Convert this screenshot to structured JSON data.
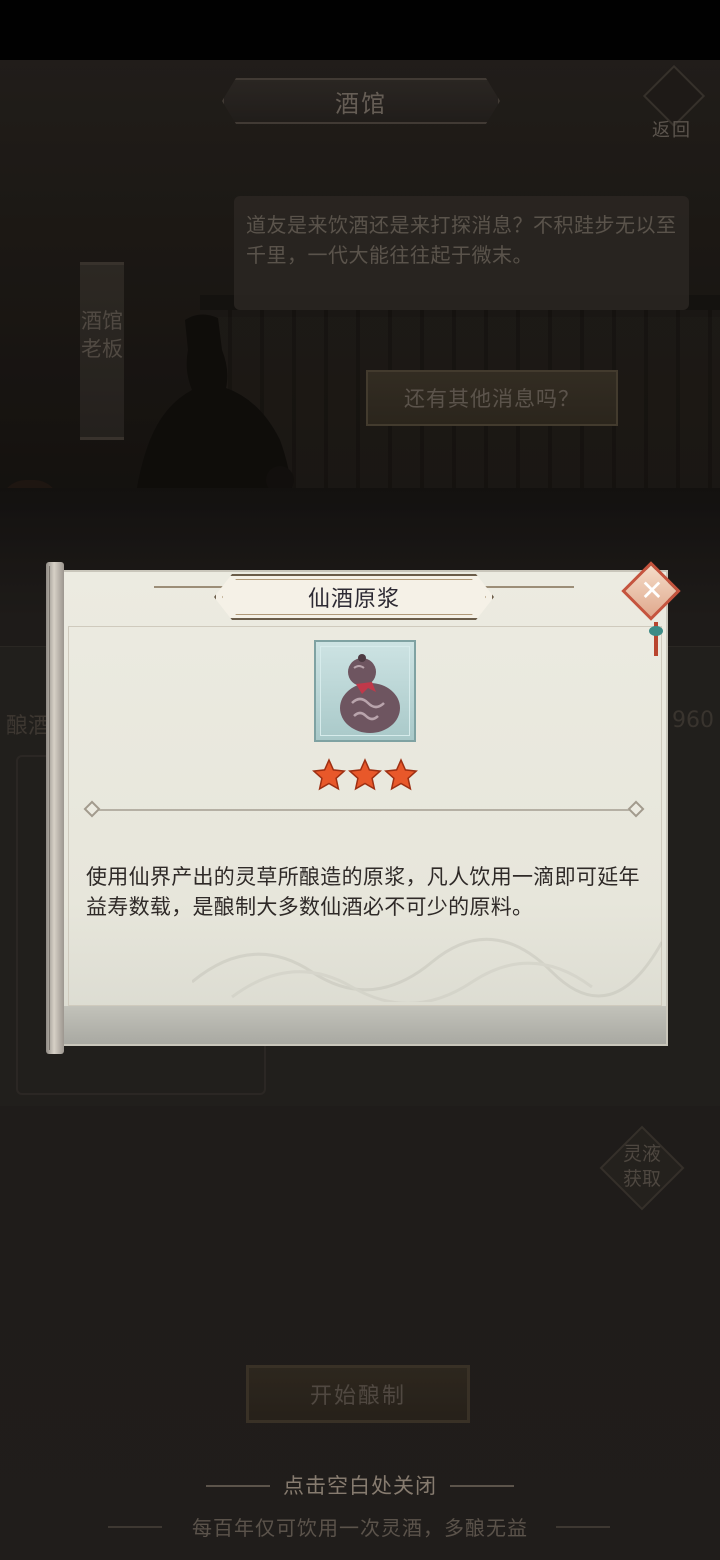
{
  "header": {
    "title": "酒馆",
    "back_label": "返回"
  },
  "dialogue": {
    "speech": "道友是来饮酒还是来打探消息？不积跬步无以至千里，一代大能往往起于微末。",
    "npc_name": "酒馆老板",
    "reply_option": "还有其他消息吗？"
  },
  "brewing": {
    "tab_label": "酿酒",
    "tab_count": "960",
    "liquid_button": "灵液获取",
    "start_button": "开始酿制",
    "close_hint": "点击空白处关闭",
    "footer_note": "每百年仅可饮用一次灵酒，多酿无益"
  },
  "item_popup": {
    "title": "仙酒原浆",
    "item_icon": "gourd-icon",
    "stars": 3,
    "description": "使用仙界产出的灵草所酿造的原浆，凡人饮用一滴即可延年益寿数载，是酿制大多数仙酒必不可少的原料。",
    "close_icon": "close-icon"
  },
  "colors": {
    "popup_paper": "#ecebe1",
    "title_text": "#2d2a33",
    "star_color": "#e8582a",
    "close_border": "#c5543e"
  }
}
